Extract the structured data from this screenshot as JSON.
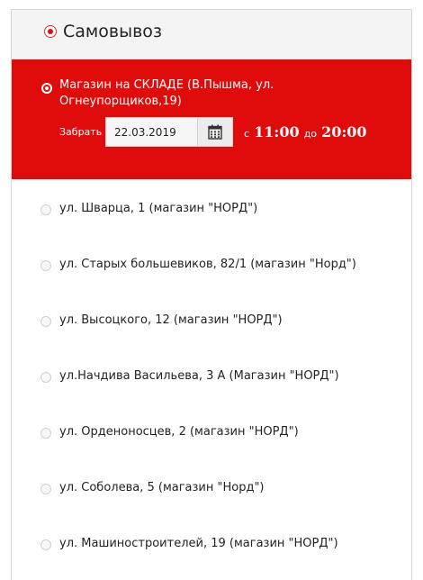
{
  "pickup": {
    "title": "Самовывоз",
    "selected": {
      "label": "Магазин на СКЛАДЕ (В.Пышма, ул. Огнеупорщиков,19)",
      "pickup_label": "Забрать",
      "date": "22.03.2019",
      "calendar_icon": "calendar-icon",
      "from_word": "с",
      "time_from": "11:00",
      "to_word": "до",
      "time_to": "20:00"
    },
    "options": [
      "ул. Шварца, 1 (магазин \"НОРД\")",
      "ул. Старых большевиков, 82/1 (магазин \"Норд\")",
      "ул. Высоцкого, 12 (магазин \"НОРД\")",
      "ул.Начдива Васильева, 3 А (Магазин \"НОРД\")",
      "ул. Орденоносцев, 2 (магазин \"НОРД\")",
      "ул. Соболева, 5 (магазин \"Норд\")",
      "ул. Машиностроителей, 19 (магазин \"НОРД\")"
    ]
  },
  "colors": {
    "accent": "#e00c0c",
    "header_bg": "#f4f4f4",
    "border": "#d6d6d6"
  }
}
